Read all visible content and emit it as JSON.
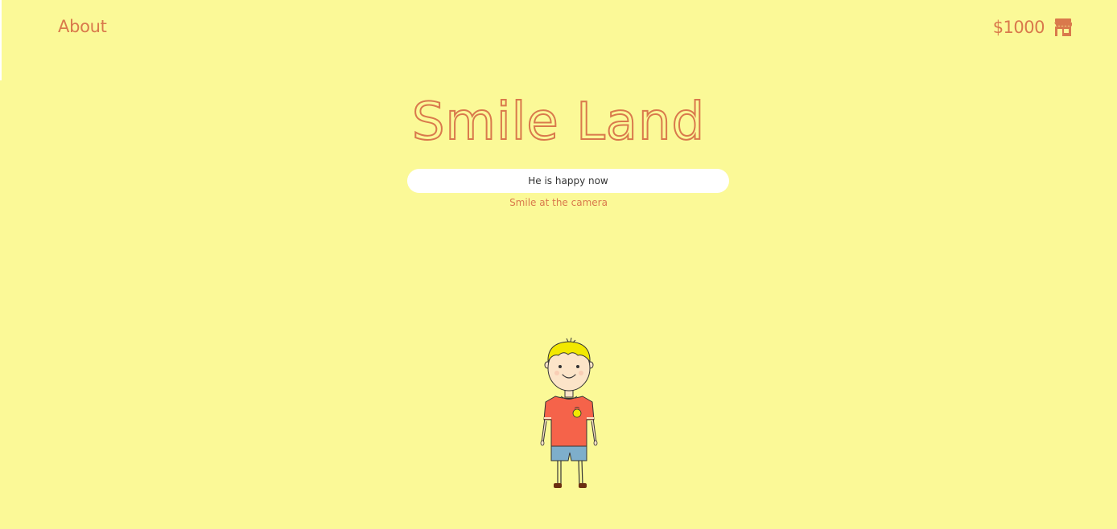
{
  "nav": {
    "about_label": "About"
  },
  "wallet": {
    "balance": "$1000",
    "shop_icon": "shop-icon"
  },
  "header": {
    "title": "Smile Land"
  },
  "status": {
    "value": "He is happy now",
    "hint": "Smile at the camera"
  },
  "character": {
    "icon": "happy-boy-character",
    "mood": "happy"
  },
  "colors": {
    "background": "#fbf997",
    "accent": "#d9794c",
    "shirt": "#f5634a",
    "shorts": "#7eaecb",
    "hair": "#f2e800"
  }
}
